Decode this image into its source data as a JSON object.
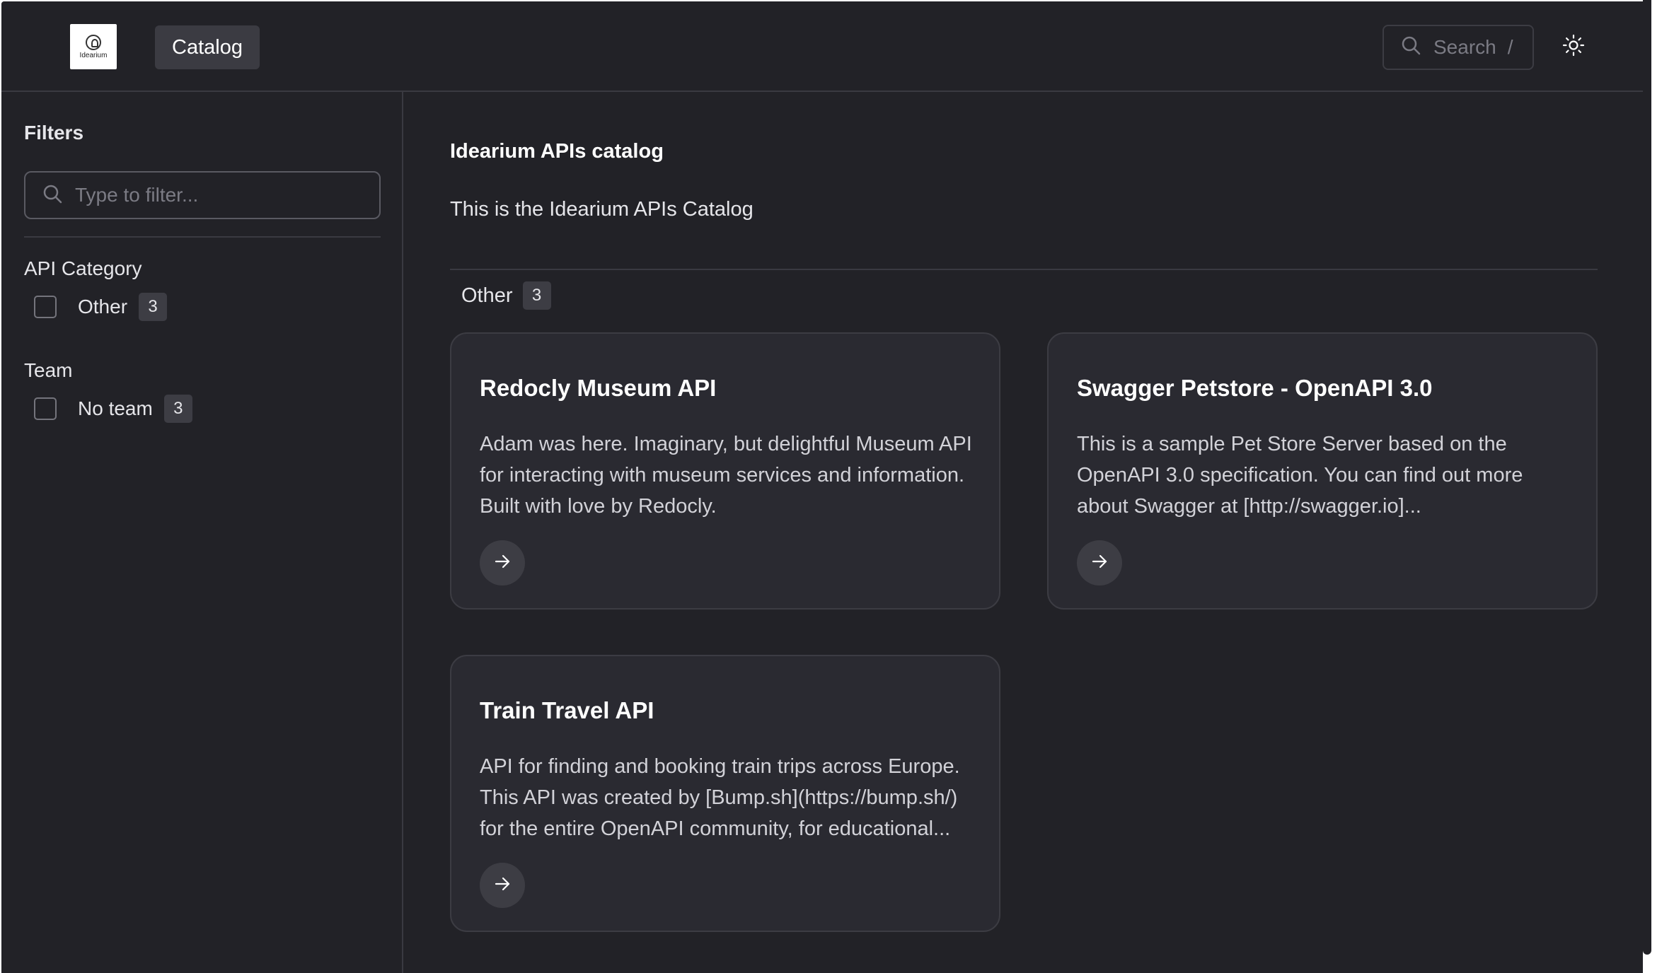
{
  "header": {
    "logo_text": "Idearium",
    "nav_catalog": "Catalog",
    "search_label": "Search",
    "search_shortcut": "/"
  },
  "sidebar": {
    "title": "Filters",
    "filter_placeholder": "Type to filter...",
    "groups": [
      {
        "title": "API Category",
        "options": [
          {
            "label": "Other",
            "count": "3",
            "checked": false
          }
        ]
      },
      {
        "title": "Team",
        "options": [
          {
            "label": "No team",
            "count": "3",
            "checked": false
          }
        ]
      }
    ]
  },
  "main": {
    "title": "Idearium APIs catalog",
    "description": "This is the Idearium APIs Catalog",
    "section": {
      "label": "Other",
      "count": "3"
    },
    "cards": [
      {
        "title": "Redocly Museum API",
        "description": "Adam was here. Imaginary, but delightful Museum API for interacting with museum services and information. Built with love by Redocly."
      },
      {
        "title": "Swagger Petstore - OpenAPI 3.0",
        "description": "This is a sample Pet Store Server based on the OpenAPI 3.0 specification. You can find out more about Swagger at [http://swagger.io]..."
      },
      {
        "title": "Train Travel API",
        "description": "API for finding and booking train trips across Europe. This API was created by [Bump.sh](https://bump.sh/) for the entire OpenAPI community, for educational..."
      }
    ]
  },
  "icons": {
    "search": "search-icon",
    "theme": "sun-icon",
    "card_link": "arrow-right-icon"
  },
  "colors": {
    "background": "#222227",
    "card_background": "#2a2a31",
    "border": "#3a3a41",
    "badge": "#3d3d44",
    "text": "#e6e6ea",
    "muted_text": "#7b7b84"
  }
}
